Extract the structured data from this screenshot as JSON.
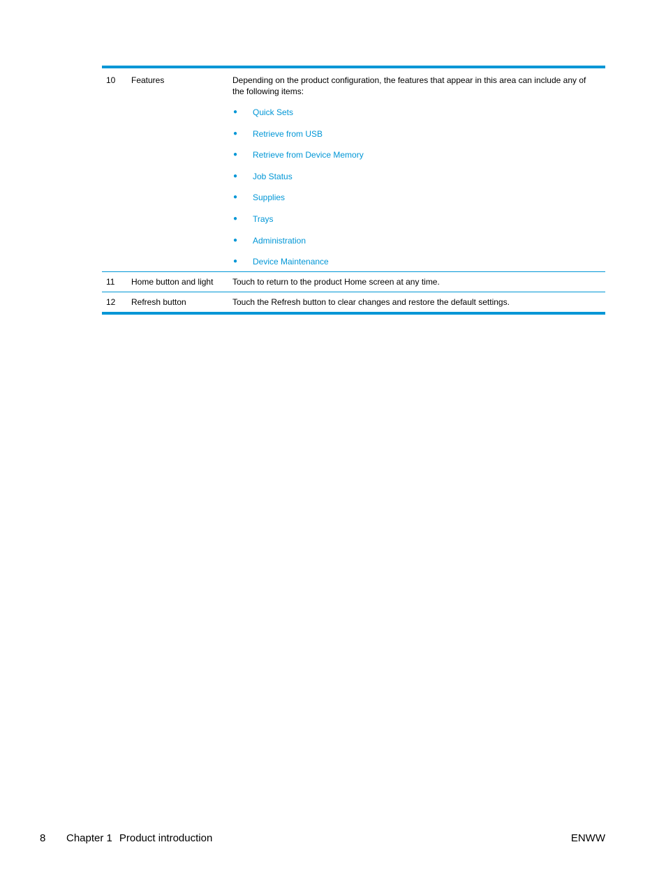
{
  "table": {
    "rows": [
      {
        "number": "10",
        "name": "Features",
        "description": "Depending on the product configuration, the features that appear in this area can include any of the following items:",
        "items": [
          "Quick Sets",
          "Retrieve from USB",
          "Retrieve from Device Memory",
          "Job Status",
          "Supplies",
          "Trays",
          "Administration",
          "Device Maintenance"
        ]
      },
      {
        "number": "11",
        "name": "Home button and light",
        "description": "Touch to return to the product Home screen at any time."
      },
      {
        "number": "12",
        "name": "Refresh button",
        "description": "Touch the Refresh button to clear changes and restore the default settings."
      }
    ]
  },
  "footer": {
    "page_number": "8",
    "chapter_label": "Chapter 1",
    "chapter_title": "Product introduction",
    "locale_code": "ENWW"
  },
  "colors": {
    "accent": "#0096d6",
    "text": "#000000"
  },
  "icons": {
    "bullet": "●"
  }
}
